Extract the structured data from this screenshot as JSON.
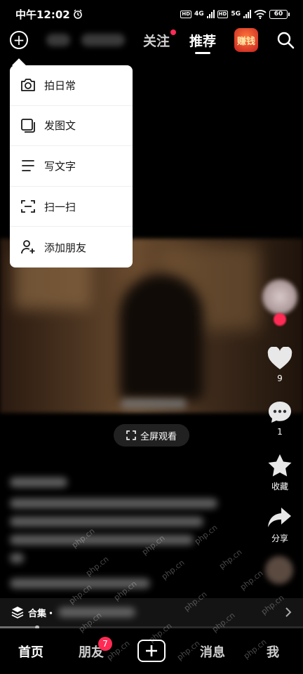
{
  "status_bar": {
    "time": "中午12:02",
    "net1": "4G",
    "net2": "5G",
    "hd": "HD",
    "battery": "60"
  },
  "top_nav": {
    "tab_follow": "关注",
    "tab_recommend": "推荐",
    "earn_label": "赚钱",
    "icons": [
      "add-circle-icon",
      "search-icon"
    ]
  },
  "popup_menu": {
    "items": [
      {
        "label": "拍日常",
        "icon": "camera-icon"
      },
      {
        "label": "发图文",
        "icon": "image-post-icon"
      },
      {
        "label": "写文字",
        "icon": "text-lines-icon"
      },
      {
        "label": "扫一扫",
        "icon": "scan-icon"
      },
      {
        "label": "添加朋友",
        "icon": "add-friend-icon"
      }
    ]
  },
  "video": {
    "fullscreen_label": "全屏观看"
  },
  "actions": {
    "like_count": "9",
    "comment_count": "1",
    "favorite_label": "收藏",
    "share_label": "分享"
  },
  "collection": {
    "label": "合集・"
  },
  "progress": 0.13,
  "bottom_nav": {
    "home": "首页",
    "friends": "朋友",
    "friends_badge": "7",
    "messages": "消息",
    "me": "我"
  },
  "watermark": "php.cn",
  "colors": {
    "accent": "#ff2b55",
    "menu_bg": "#ffffff",
    "bg": "#000000"
  }
}
